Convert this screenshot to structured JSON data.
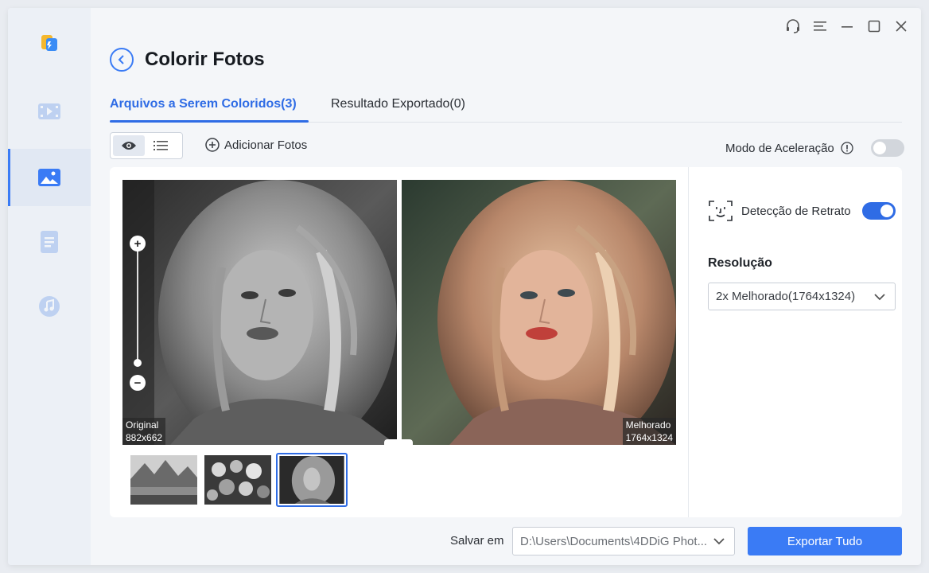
{
  "window": {
    "title": "Colorir Fotos",
    "controls": [
      "headset-icon",
      "menu-icon",
      "minimize-icon",
      "maximize-icon",
      "close-icon"
    ]
  },
  "sidebar": {
    "items": [
      {
        "name": "logo",
        "icon": "app-logo-icon",
        "active": false
      },
      {
        "name": "video",
        "icon": "video-icon",
        "active": false
      },
      {
        "name": "photo",
        "icon": "image-icon",
        "active": true
      },
      {
        "name": "document",
        "icon": "document-icon",
        "active": false
      },
      {
        "name": "audio",
        "icon": "music-icon",
        "active": false
      }
    ]
  },
  "tabs": [
    {
      "label": "Arquivos a Serem Coloridos(3)",
      "active": true
    },
    {
      "label": "Resultado Exportado(0)",
      "active": false
    }
  ],
  "toolbar": {
    "add_photos": "Adicionar Fotos",
    "acceleration_label": "Modo de Aceleração",
    "acceleration_on": false
  },
  "preview": {
    "original_label": "Original",
    "original_size": "882x662",
    "enhanced_label": "Melhorado",
    "enhanced_size": "1764x1324"
  },
  "thumbnails": [
    {
      "name": "mountain-lake",
      "selected": false
    },
    {
      "name": "flowers",
      "selected": false
    },
    {
      "name": "portrait",
      "selected": true
    }
  ],
  "settings": {
    "portrait_detection_label": "Detecção de Retrato",
    "portrait_detection_on": true,
    "resolution_title": "Resolução",
    "resolution_value": "2x Melhorado(1764x1324)"
  },
  "footer": {
    "save_label": "Salvar em",
    "save_path": "D:\\Users\\Documents\\4DDiG Phot...",
    "export_button": "Exportar Tudo"
  },
  "colors": {
    "accent": "#3a7bf5",
    "tab_active": "#2f6ce5"
  }
}
